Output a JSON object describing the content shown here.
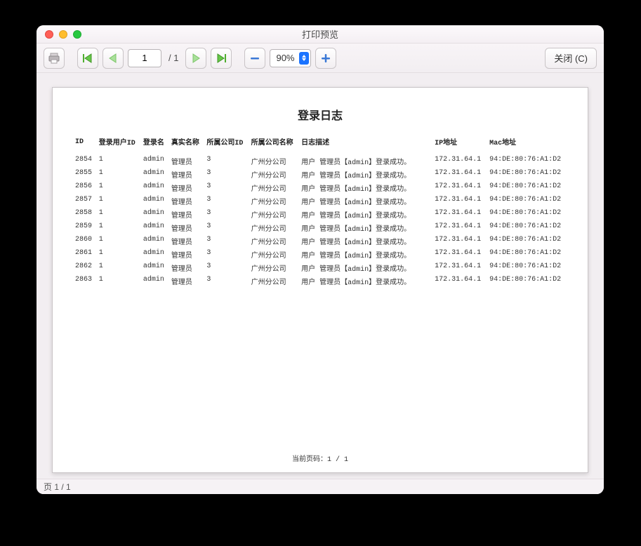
{
  "window": {
    "title": "打印预览"
  },
  "toolbar": {
    "page_value": "1",
    "page_total": "/ 1",
    "zoom": "90%",
    "close_label": "关闭 (C)"
  },
  "report": {
    "title": "登录日志",
    "columns": [
      "ID",
      "登录用户ID",
      "登录名",
      "真实名称",
      "所属公司ID",
      "所属公司名称",
      "日志描述",
      "IP地址",
      "Mac地址"
    ],
    "rows": [
      {
        "id": "2854",
        "user_id": "1",
        "login": "admin",
        "realname": "管理员",
        "company_id": "3",
        "company_name": "广州分公司",
        "desc": "用户 管理员【admin】登录成功。",
        "ip": "172.31.64.1",
        "mac": "94:DE:80:76:A1:D2"
      },
      {
        "id": "2855",
        "user_id": "1",
        "login": "admin",
        "realname": "管理员",
        "company_id": "3",
        "company_name": "广州分公司",
        "desc": "用户 管理员【admin】登录成功。",
        "ip": "172.31.64.1",
        "mac": "94:DE:80:76:A1:D2"
      },
      {
        "id": "2856",
        "user_id": "1",
        "login": "admin",
        "realname": "管理员",
        "company_id": "3",
        "company_name": "广州分公司",
        "desc": "用户 管理员【admin】登录成功。",
        "ip": "172.31.64.1",
        "mac": "94:DE:80:76:A1:D2"
      },
      {
        "id": "2857",
        "user_id": "1",
        "login": "admin",
        "realname": "管理员",
        "company_id": "3",
        "company_name": "广州分公司",
        "desc": "用户 管理员【admin】登录成功。",
        "ip": "172.31.64.1",
        "mac": "94:DE:80:76:A1:D2"
      },
      {
        "id": "2858",
        "user_id": "1",
        "login": "admin",
        "realname": "管理员",
        "company_id": "3",
        "company_name": "广州分公司",
        "desc": "用户 管理员【admin】登录成功。",
        "ip": "172.31.64.1",
        "mac": "94:DE:80:76:A1:D2"
      },
      {
        "id": "2859",
        "user_id": "1",
        "login": "admin",
        "realname": "管理员",
        "company_id": "3",
        "company_name": "广州分公司",
        "desc": "用户 管理员【admin】登录成功。",
        "ip": "172.31.64.1",
        "mac": "94:DE:80:76:A1:D2"
      },
      {
        "id": "2860",
        "user_id": "1",
        "login": "admin",
        "realname": "管理员",
        "company_id": "3",
        "company_name": "广州分公司",
        "desc": "用户 管理员【admin】登录成功。",
        "ip": "172.31.64.1",
        "mac": "94:DE:80:76:A1:D2"
      },
      {
        "id": "2861",
        "user_id": "1",
        "login": "admin",
        "realname": "管理员",
        "company_id": "3",
        "company_name": "广州分公司",
        "desc": "用户 管理员【admin】登录成功。",
        "ip": "172.31.64.1",
        "mac": "94:DE:80:76:A1:D2"
      },
      {
        "id": "2862",
        "user_id": "1",
        "login": "admin",
        "realname": "管理员",
        "company_id": "3",
        "company_name": "广州分公司",
        "desc": "用户 管理员【admin】登录成功。",
        "ip": "172.31.64.1",
        "mac": "94:DE:80:76:A1:D2"
      },
      {
        "id": "2863",
        "user_id": "1",
        "login": "admin",
        "realname": "管理员",
        "company_id": "3",
        "company_name": "广州分公司",
        "desc": "用户 管理员【admin】登录成功。",
        "ip": "172.31.64.1",
        "mac": "94:DE:80:76:A1:D2"
      }
    ],
    "footer": "当前页码：1 / 1"
  },
  "status": {
    "text": "页 1 / 1"
  }
}
